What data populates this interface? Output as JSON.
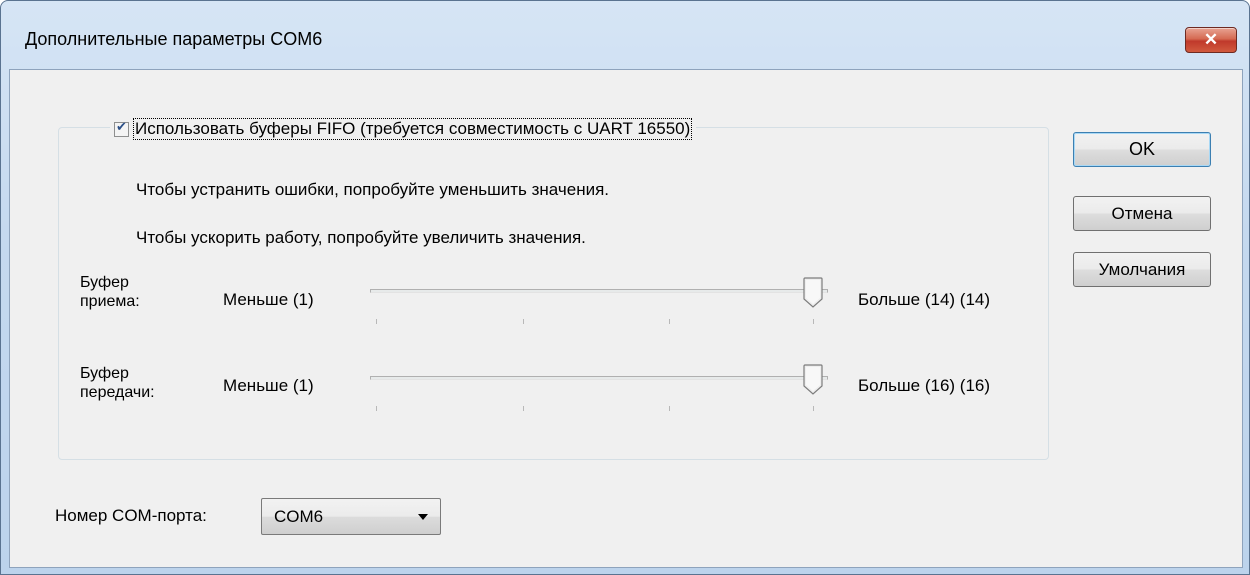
{
  "window": {
    "title": "Дополнительные параметры COM6",
    "close_symbol": "✕"
  },
  "fifo": {
    "checkbox_checked": true,
    "label": "Использовать буферы FIFO (требуется совместимость с UART 16550)",
    "hint_errors": "Чтобы устранить ошибки, попробуйте уменьшить значения.",
    "hint_speed": "Чтобы ускорить работу, попробуйте увеличить значения."
  },
  "receive_buffer": {
    "label_line1": "Буфер",
    "label_line2": "приема:",
    "min_label": "Меньше (1)",
    "max_label": "Больше (14) (14)",
    "min": 1,
    "max": 14,
    "value": 14
  },
  "transmit_buffer": {
    "label_line1": "Буфер",
    "label_line2": "передачи:",
    "min_label": "Меньше (1)",
    "max_label": "Больше (16) (16)",
    "min": 1,
    "max": 16,
    "value": 16
  },
  "buttons": {
    "ok": "OK",
    "cancel": "Отмена",
    "defaults": "Умолчания"
  },
  "com_port": {
    "label": "Номер COM-порта:",
    "selected": "COM6"
  },
  "icons": {
    "close": "close-icon",
    "check": "checkmark-icon",
    "dropdown": "chevron-down-icon",
    "slider_thumb": "slider-thumb-icon"
  }
}
